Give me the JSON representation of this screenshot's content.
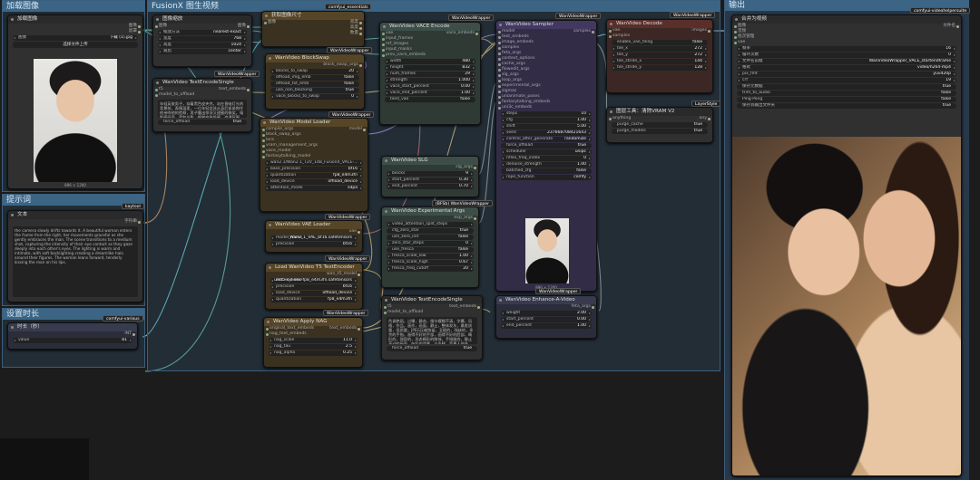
{
  "groups": {
    "load_image": "加载图像",
    "fusionx": "FusionX 图生视频",
    "prompt": "提示词",
    "duration": "设置时长",
    "output": "输出"
  },
  "badges": {
    "essentials": "comfyui_essentials",
    "wvw": "WanVideoWrapper",
    "kaytool": "kaytool",
    "various": "comfyui-various",
    "layerstyle": "LayerStyle",
    "vhs": "comfyui-videohelpersuite",
    "fbs": "(BFSb) WanVideoWrapper"
  },
  "load_image_node": {
    "title": "加载图像",
    "out_image": "图像",
    "out_mask": "遮罩",
    "image_label": "图像",
    "image_file": "下载 (1).jpg",
    "upload_btn": "选择文件上传",
    "caption": "896 × 1200"
  },
  "image_scale_node": {
    "title": "图像缩放",
    "in_image": "图像",
    "out_image": "图像",
    "upscale_label": "缩放方法",
    "upscale_value": "nearest-exact",
    "width_label": "宽度",
    "width_value": "768",
    "height_label": "高度",
    "height_value": "1024",
    "crop_label": "裁剪",
    "crop_value": "center"
  },
  "text_encode1": {
    "title": "WanVideo TextEncodeSingle",
    "in_t5": "t5",
    "in_model": "model_to_offload",
    "out_embeds": "text_embeds",
    "prompt": "年轻英俊男子，穿着黑色皮夹克，站在昏暗灯光的背景前，表情温柔，一位年轻女孩从身后紧紧抱住他亲吻他的脸颊，男子露出惊讶又甜蜜的微笑，电影感画面，柔和光影，细腻皮肤质感，浪漫氛围。",
    "force_label": "force_offload",
    "force_value": "true"
  },
  "get_size_node": {
    "title": "获取图像尺寸",
    "in_image": "图像",
    "out_width": "宽度",
    "out_height": "高度",
    "out_count": "数量"
  },
  "block_swap": {
    "title": "WanVideo BlockSwap",
    "out": "block_swap_args",
    "r1_l": "blocks_to_swap",
    "r1_v": "20",
    "r2_l": "offload_img_emb",
    "r2_v": "false",
    "r3_l": "offload_txt_emb",
    "r3_v": "false",
    "r4_l": "use_non_blocking",
    "r4_v": "true",
    "r5_l": "vace_blocks_to_swap",
    "r5_v": "0"
  },
  "model_loader": {
    "title": "WanVideo Model Loader",
    "in1": "compile_args",
    "in2": "block_swap_args",
    "in3": "lora",
    "in4": "vram_management_args",
    "in5": "vace_model",
    "in6": "fantasytalking_model",
    "out": "model",
    "model_value": "wan2.1/Wan2.1_T2V_14B_FusionX_VACE-...",
    "r1_l": "base_precision",
    "r1_v": "bf16",
    "r2_l": "quantization",
    "r2_v": "fp8_e4m3fn",
    "r3_l": "load_device",
    "r3_v": "offload_device",
    "r4_l": "attention_mode",
    "r4_v": "sdpa"
  },
  "vae_loader": {
    "title": "WanVideo VAE Loader",
    "out": "vae",
    "r1_l": "model_name",
    "r1_v": "Wan2_1_VAE_bf16.safetensors",
    "r2_l": "precision",
    "r2_v": "bf16"
  },
  "t5_encoder": {
    "title": "Load WanVideo T5 TextEncoder",
    "out": "wan_t5_model",
    "r1_l": "model_name",
    "r1_v": "umt5-xxl-enc-fp8_e4m3fn.safetensors",
    "r2_l": "precision",
    "r2_v": "bf16",
    "r3_l": "load_device",
    "r3_v": "offload_device",
    "r4_l": "quantization",
    "r4_v": "fp8_e4m3fn"
  },
  "nag": {
    "title": "WanVideo Apply NAG",
    "in1": "original_text_embeds",
    "in2": "nag_text_embeds",
    "out": "text_embeds",
    "r1_l": "nag_scale",
    "r1_v": "11.0",
    "r2_l": "nag_tau",
    "r2_v": "2.5",
    "r3_l": "nag_alpha",
    "r3_v": "0.25"
  },
  "vace_encode": {
    "title": "WanVideo VACE Encode",
    "in1": "vae",
    "in2": "input_frames",
    "in3": "ref_images",
    "in4": "input_masks",
    "in5": "prev_vace_embeds",
    "out": "vace_embeds",
    "r1_l": "width",
    "r1_v": "480",
    "r2_l": "height",
    "r2_v": "832",
    "r3_l": "num_frames",
    "r3_v": "29",
    "r4_l": "strength",
    "r4_v": "1.000",
    "r5_l": "vace_start_percent",
    "r5_v": "0.00",
    "r6_l": "vace_end_percent",
    "r6_v": "1.00",
    "r7_l": "tiled_vae",
    "r7_v": "false"
  },
  "slg": {
    "title": "WanVideo SLG",
    "out": "slg_args",
    "r1_l": "blocks",
    "r1_v": "9",
    "r2_l": "start_percent",
    "r2_v": "0.30",
    "r3_l": "end_percent",
    "r3_v": "0.70"
  },
  "exp_args": {
    "title": "WanVideo Experimental Args",
    "out": "exp_args",
    "r1_l": "video_attention_split_steps",
    "r1_v": "",
    "r2_l": "cfg_zero_star",
    "r2_v": "true",
    "r3_l": "use_zero_init",
    "r3_v": "false",
    "r4_l": "zero_star_steps",
    "r4_v": "0",
    "r5_l": "use_fresca",
    "r5_v": "false",
    "r6_l": "fresca_scale_low",
    "r6_v": "1.00",
    "r7_l": "fresca_scale_high",
    "r7_v": "0.67",
    "r8_l": "fresca_freq_cutoff",
    "r8_v": "20"
  },
  "text_encode2": {
    "title": "WanVideo TextEncodeSingle",
    "in_t5": "t5",
    "in_model": "model_to_offload",
    "out": "text_embeds",
    "prompt": "色调艳丽，过曝，静态，细节模糊不清，字幕，风格，作品，画作，画面，静止，整体发灰，最差质量，低质量，JPEG压缩残留，丑陋的，残缺的，多余的手指，画得不好的手部，画得不好的脸部，畸形的，毁容的，形态畸形的肢体，手指融合，静止不动的画面，杂乱的背景，三条腿，背景人很多，倒着走",
    "force_label": "force_offload",
    "force_value": "true"
  },
  "sampler": {
    "title": "WanVideo Sampler",
    "out": "samples",
    "ins": [
      "model",
      "text_embeds",
      "image_embeds",
      "samples",
      "feta_args",
      "context_options",
      "cache_args",
      "flowedit_args",
      "slg_args",
      "loop_args",
      "experimental_args",
      "sigmas",
      "unianimate_poses",
      "fantasytalking_embeds",
      "uni3c_embeds"
    ],
    "r1_l": "steps",
    "r1_v": "10",
    "r2_l": "cfg",
    "r2_v": "1.00",
    "r3_l": "shift",
    "r3_v": "5.00",
    "r4_l": "seed",
    "r4_v": "237668708421643",
    "r5_l": "control_after_generate",
    "r5_v": "randomize",
    "r6_l": "force_offload",
    "r6_v": "true",
    "r7_l": "scheduler",
    "r7_v": "unipc",
    "r8_l": "riflex_freq_index",
    "r8_v": "0",
    "r9_l": "denoise_strength",
    "r9_v": "1.00",
    "r10_l": "batched_cfg",
    "r10_v": "false",
    "r11_l": "rope_function",
    "r11_v": "comfy",
    "caption": "896 × 1200"
  },
  "decode": {
    "title": "WanVideo Decode",
    "in1": "vae",
    "in2": "samples",
    "out": "images",
    "r1_l": "enable_vae_tiling",
    "r1_v": "false",
    "r2_l": "tile_x",
    "r2_v": "272",
    "r3_l": "tile_y",
    "r3_v": "272",
    "r4_l": "tile_stride_x",
    "r4_v": "144",
    "r5_l": "tile_stride_y",
    "r5_v": "128"
  },
  "vram": {
    "title": "图层工具：清除VRAM V2",
    "in": "anything",
    "out": "any",
    "r1_l": "purge_cache",
    "r1_v": "true",
    "r2_l": "purge_models",
    "r2_v": "true"
  },
  "enhance": {
    "title": "WanVideo Enhance-A-Video",
    "out": "feta_args",
    "r1_l": "weight",
    "r1_v": "2.00",
    "r2_l": "start_percent",
    "r2_v": "0.00",
    "r3_l": "end_percent",
    "r3_v": "1.00"
  },
  "prompt_node": {
    "title": "文本",
    "out": "字符串",
    "text": "the camera slowly drifts towards it. A beautiful woman enters the frame from the right, her movements graceful as she gently embraces the man. The scene transitions to a medium shot, capturing the intensity of their eye contact as they gaze deeply into each other's eyes. The lighting is warm and intimate, with soft backlighting creating a dreamlike halo around their figures. The woman leans forward, tenderly kissing the man on his lips."
  },
  "duration_node": {
    "title": "时长（秒）",
    "out": "INT",
    "label": "value",
    "value": "81"
  },
  "combine": {
    "title": "合并为视频",
    "in1": "图像",
    "in2": "音频",
    "in3": "批次管理",
    "in4": "vae",
    "out": "文件名",
    "r1_l": "帧率",
    "r1_v": "16",
    "r2_l": "循环次数",
    "r2_v": "0",
    "r3_l": "文件名前缀",
    "r3_v": "WanVideoWrapper_VACE_startendframe",
    "r4_l": "格式",
    "r4_v": "video/h264-mp4",
    "r5_l": "pix_fmt",
    "r5_v": "yuv420p",
    "r6_l": "crf",
    "r6_v": "19",
    "r7_l": "保存元数据",
    "r7_v": "true",
    "r8_l": "trim_to_audio",
    "r8_v": "false",
    "r9_l": "Ping-Pong",
    "r9_v": "false",
    "r10_l": "保存到输出文件夹",
    "r10_v": "true"
  }
}
